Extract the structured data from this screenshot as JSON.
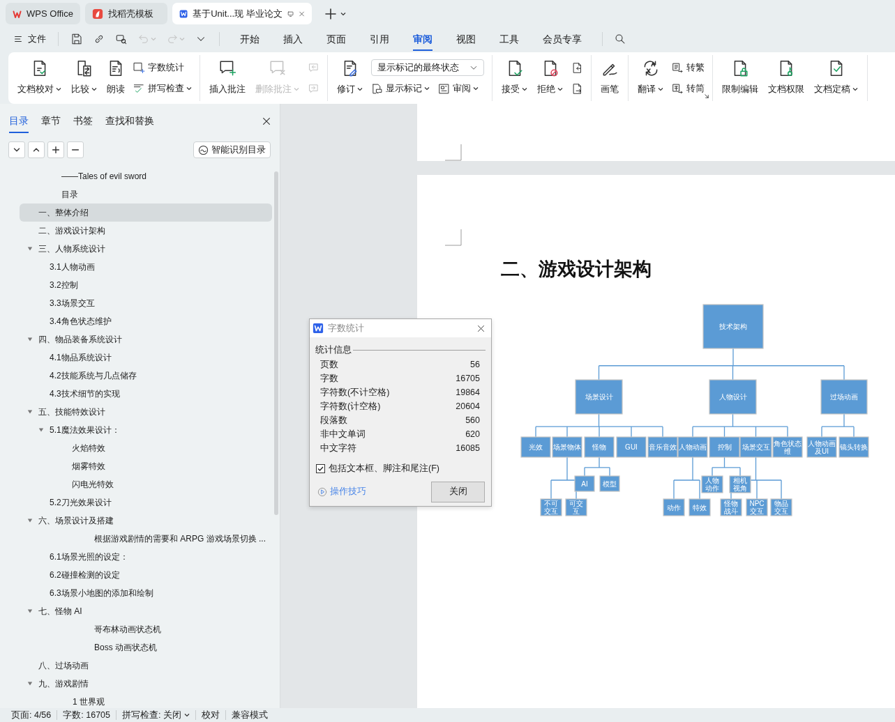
{
  "tabs": [
    {
      "kind": "home",
      "label": "WPS Office",
      "selected": false
    },
    {
      "kind": "template",
      "label": "找稻壳模板",
      "selected": false
    },
    {
      "kind": "document",
      "label": "基于Unit...现 毕业论文",
      "selected": true
    }
  ],
  "menu": {
    "file": "文件",
    "quick_access": [
      {
        "disabled": false
      },
      {
        "disabled": false
      },
      {
        "disabled": false
      },
      {
        "disabled": true
      },
      {
        "disabled": true
      },
      {
        "disabled": false
      }
    ],
    "tabs": [
      {
        "label": "开始",
        "selected": false
      },
      {
        "label": "插入",
        "selected": false
      },
      {
        "label": "页面",
        "selected": false
      },
      {
        "label": "引用",
        "selected": false
      },
      {
        "label": "审阅",
        "selected": true
      },
      {
        "label": "视图",
        "selected": false
      },
      {
        "label": "工具",
        "selected": false
      },
      {
        "label": "会员专享",
        "selected": false
      }
    ]
  },
  "ribbon": {
    "groups": [
      {
        "items": [
          {
            "kind": "large",
            "label": "文档校对",
            "dropdown": true,
            "disabled": false
          },
          {
            "kind": "large",
            "label": "比较",
            "dropdown": true,
            "disabled": false
          },
          {
            "kind": "large",
            "label": "朗读",
            "dropdown": false,
            "disabled": false
          },
          {
            "kind": "stack",
            "items": [
              {
                "label": "字数统计",
                "dropdown": false,
                "disabled": false
              },
              {
                "label": "拼写检查",
                "dropdown": true,
                "disabled": false
              }
            ]
          }
        ]
      },
      {
        "items": [
          {
            "kind": "large",
            "label": "插入批注",
            "dropdown": false,
            "disabled": false
          },
          {
            "kind": "large",
            "label": "删除批注",
            "dropdown": true,
            "disabled": true
          },
          {
            "kind": "stack",
            "items": [
              {
                "disabled": true
              },
              {
                "disabled": true
              }
            ]
          }
        ]
      },
      {
        "items": [
          {
            "kind": "large",
            "label": "修订",
            "dropdown": true,
            "disabled": false
          },
          {
            "kind": "select-stack",
            "value": "显示标记的最终状态",
            "items": [
              {
                "label": "显示标记",
                "dropdown": true,
                "disabled": false
              },
              {
                "label": "审阅",
                "dropdown": true,
                "disabled": false
              }
            ]
          }
        ]
      },
      {
        "items": [
          {
            "kind": "large",
            "label": "接受",
            "dropdown": true,
            "disabled": false
          },
          {
            "kind": "large",
            "label": "拒绝",
            "dropdown": true,
            "disabled": false
          },
          {
            "kind": "stack",
            "items": [
              {
                "disabled": false
              },
              {
                "disabled": false
              }
            ]
          }
        ]
      },
      {
        "items": [
          {
            "kind": "large",
            "label": "画笔",
            "dropdown": false,
            "disabled": false
          }
        ]
      },
      {
        "launcher": true,
        "items": [
          {
            "kind": "large",
            "label": "翻译",
            "dropdown": true,
            "disabled": false
          },
          {
            "kind": "stack",
            "items": [
              {
                "label": "转繁",
                "dropdown": false,
                "disabled": false
              },
              {
                "label": "转简",
                "dropdown": false,
                "disabled": false
              }
            ]
          }
        ]
      },
      {
        "items": [
          {
            "kind": "large",
            "label": "限制编辑",
            "dropdown": false,
            "disabled": false
          },
          {
            "kind": "large",
            "label": "文档权限",
            "dropdown": false,
            "disabled": false
          },
          {
            "kind": "large",
            "label": "文档定稿",
            "dropdown": true,
            "disabled": false
          }
        ]
      }
    ]
  },
  "nav": {
    "tabs": [
      {
        "label": "目录",
        "selected": true
      },
      {
        "label": "章节",
        "selected": false
      },
      {
        "label": "书签",
        "selected": false
      },
      {
        "label": "查找和替换",
        "selected": false
      }
    ],
    "smart_toc": "智能识别目录",
    "toc": [
      {
        "kind": "title",
        "text": "——Tales of evil sword",
        "selected": false
      },
      {
        "kind": "title",
        "text": "目录",
        "selected": false
      },
      {
        "kind": "heading",
        "text": "一、整体介绍",
        "selected": true
      },
      {
        "kind": "heading",
        "text": "二、游戏设计架构",
        "selected": false
      },
      {
        "kind": "heading",
        "text": "三、人物系统设计",
        "selected": false,
        "expanded": true,
        "children": [
          {
            "kind": "heading",
            "text": "3.1人物动画",
            "selected": false
          },
          {
            "kind": "heading",
            "text": "3.2控制",
            "selected": false
          },
          {
            "kind": "heading",
            "text": "3.3场景交互",
            "selected": false
          },
          {
            "kind": "heading",
            "text": "3.4角色状态维护",
            "selected": false
          }
        ]
      },
      {
        "kind": "heading",
        "text": "四、物品装备系统设计",
        "selected": false,
        "expanded": true,
        "children": [
          {
            "kind": "heading",
            "text": "4.1物品系统设计",
            "selected": false
          },
          {
            "kind": "heading",
            "text": "4.2技能系统与几点储存",
            "selected": false
          },
          {
            "kind": "heading",
            "text": "4.3技术细节的实现",
            "selected": false
          }
        ]
      },
      {
        "kind": "heading",
        "text": "五、技能特效设计",
        "selected": false,
        "expanded": true,
        "children": [
          {
            "kind": "heading",
            "text": "5.1魔法效果设计：",
            "selected": false,
            "expanded": true,
            "children": [
              {
                "kind": "heading",
                "text": "火焰特效",
                "selected": false
              },
              {
                "kind": "heading",
                "text": "烟雾特效",
                "selected": false
              },
              {
                "kind": "heading",
                "text": "闪电光特效",
                "selected": false
              }
            ]
          },
          {
            "kind": "heading",
            "text": "5.2刀光效果设计",
            "selected": false
          }
        ]
      },
      {
        "kind": "heading",
        "text": "六、场景设计及搭建",
        "selected": false,
        "expanded": true,
        "children": [
          {
            "kind": "body",
            "text": "根据游戏剧情的需要和 ARPG 游戏场景切换 ...",
            "selected": false
          },
          {
            "kind": "heading",
            "text": "6.1场景光照的设定：",
            "selected": false
          },
          {
            "kind": "heading",
            "text": "6.2碰撞检测的设定",
            "selected": false
          },
          {
            "kind": "heading",
            "text": "6.3场景小地图的添加和绘制",
            "selected": false
          }
        ]
      },
      {
        "kind": "heading",
        "text": "七、怪物 AI",
        "selected": false,
        "expanded": true,
        "children": [
          {
            "kind": "body",
            "text": "哥布林动画状态机",
            "selected": false
          },
          {
            "kind": "body",
            "text": "Boss 动画状态机",
            "selected": false
          }
        ]
      },
      {
        "kind": "heading",
        "text": "八、过场动画",
        "selected": false
      },
      {
        "kind": "heading",
        "text": "九、游戏剧情",
        "selected": false,
        "expanded": true,
        "children": [
          {
            "kind": "list",
            "text": "1  世界观",
            "selected": false
          }
        ]
      }
    ]
  },
  "document": {
    "heading": "二、游戏设计架构",
    "diagram": {
      "label": "技术架构",
      "children": [
        {
          "label": "场景设计",
          "children": [
            {
              "label": "光效"
            },
            {
              "label": "场景物体",
              "children": [
                {
                  "label": "不可交互"
                },
                {
                  "label": "可交互"
                }
              ]
            },
            {
              "label": "怪物",
              "children": [
                {
                  "label": "AI"
                },
                {
                  "label": "模型"
                }
              ]
            },
            {
              "label": "GUI"
            },
            {
              "label": "音乐音效"
            }
          ]
        },
        {
          "label": "人物设计",
          "children": [
            {
              "label": "人物动画",
              "children": [
                {
                  "label": "动作"
                },
                {
                  "label": "特效"
                }
              ]
            },
            {
              "label": "控制",
              "children": [
                {
                  "label": "人物动作"
                },
                {
                  "label": "相机视角"
                }
              ]
            },
            {
              "label": "场景交互",
              "children": [
                {
                  "label": "怪物战斗"
                },
                {
                  "label": "NPC交互"
                },
                {
                  "label": "物品交互"
                }
              ]
            },
            {
              "label": "角色状态维"
            }
          ]
        },
        {
          "label": "过场动画",
          "children": [
            {
              "label": "人物动画及UI"
            },
            {
              "label": "镜头转换"
            }
          ]
        }
      ]
    }
  },
  "dialog": {
    "title": "字数统计",
    "group": "统计信息",
    "rows": [
      {
        "label": "页数",
        "value": "56"
      },
      {
        "label": "字数",
        "value": "16705"
      },
      {
        "label": "字符数(不计空格)",
        "value": "19864"
      },
      {
        "label": "字符数(计空格)",
        "value": "20604"
      },
      {
        "label": "段落数",
        "value": "560"
      },
      {
        "label": "非中文单词",
        "value": "620"
      },
      {
        "label": "中文字符",
        "value": "16085"
      }
    ],
    "include": {
      "label": "包括文本框、脚注和尾注(F)",
      "checked": true
    },
    "tips": "操作技巧",
    "close": "关闭"
  },
  "status_bar": [
    {
      "text": "页面: 4/56",
      "dropdown": false
    },
    {
      "text": "字数: 16705",
      "dropdown": false
    },
    {
      "text": "拼写检查: 关闭",
      "dropdown": true
    },
    {
      "text": "校对",
      "dropdown": false
    },
    {
      "text": "兼容模式",
      "dropdown": false
    }
  ]
}
